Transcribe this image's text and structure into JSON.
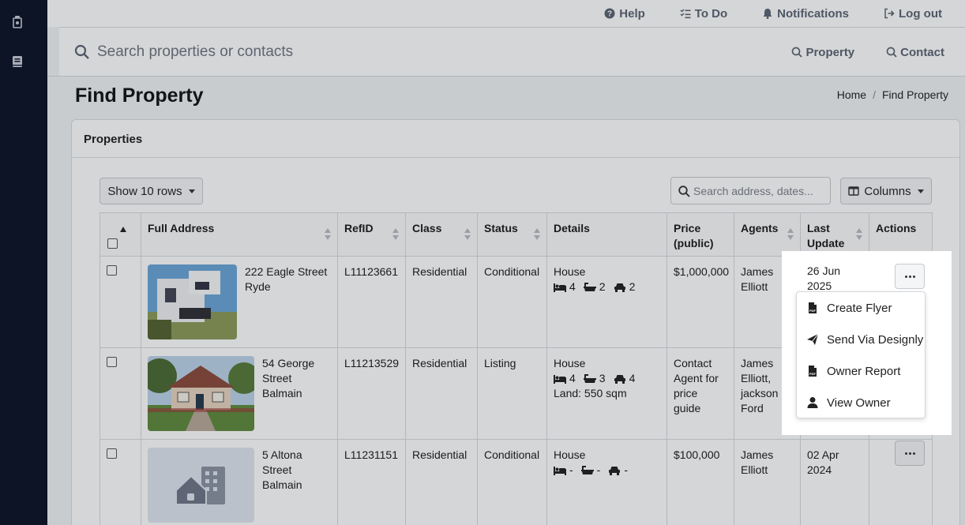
{
  "topnav": {
    "help": "Help",
    "todo": "To Do",
    "notifications": "Notifications",
    "logout": "Log out"
  },
  "search": {
    "placeholder": "Search properties or contacts",
    "property_link": "Property",
    "contact_link": "Contact"
  },
  "page": {
    "title": "Find Property",
    "breadcrumb": [
      "Home",
      "Find Property"
    ]
  },
  "card": {
    "title": "Properties",
    "show_rows": "Show 10 rows",
    "table_search_placeholder": "Search address, dates...",
    "columns_label": "Columns"
  },
  "table": {
    "headers": [
      "Full Address",
      "RefID",
      "Class",
      "Status",
      "Details",
      "Price (public)",
      "Agents",
      "Last Update",
      "Actions"
    ],
    "rows": [
      {
        "address_line1": "222 Eagle Street",
        "address_line2": "Ryde",
        "refid": "L11123661",
        "class": "Residential",
        "status": "Conditional",
        "type": "House",
        "beds": "4",
        "baths": "2",
        "cars": "2",
        "land": "",
        "price": "$1,000,000",
        "agents": "James Elliott",
        "last_update": "26 Jun 2025"
      },
      {
        "address_line1": "54 George Street",
        "address_line2": "Balmain",
        "refid": "L11213529",
        "class": "Residential",
        "status": "Listing",
        "type": "House",
        "beds": "4",
        "baths": "3",
        "cars": "4",
        "land": "Land: 550 sqm",
        "price": "Contact Agent for price guide",
        "agents": "James Elliott, jackson Ford",
        "last_update": ""
      },
      {
        "address_line1": "5 Altona Street",
        "address_line2": "Balmain",
        "refid": "L11231151",
        "class": "Residential",
        "status": "Conditional",
        "type": "House",
        "beds": "-",
        "baths": "-",
        "cars": "-",
        "land": "",
        "price": "$100,000",
        "agents": "James Elliott",
        "last_update": "02 Apr 2024"
      }
    ]
  },
  "actions_menu": {
    "items": [
      "Create Flyer",
      "Send Via Designly",
      "Owner Report",
      "View Owner"
    ]
  },
  "colors": {
    "sidebar": "#0a1326",
    "text_muted": "#5b6475"
  }
}
